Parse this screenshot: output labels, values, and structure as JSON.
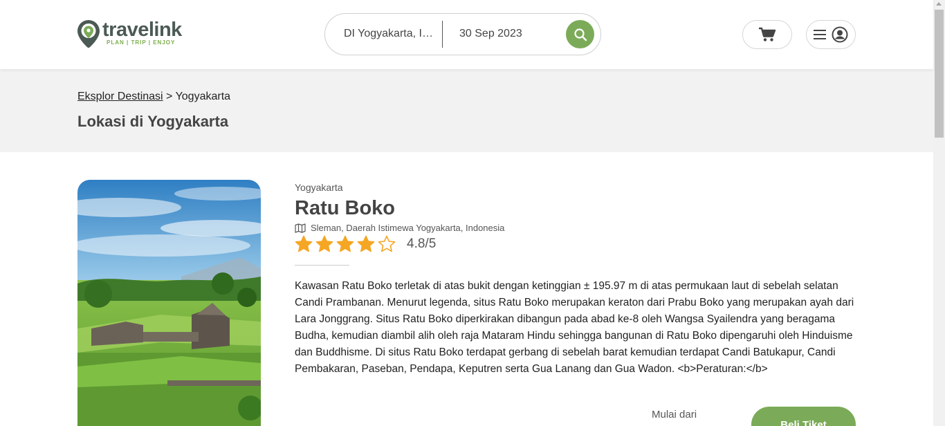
{
  "header": {
    "logo_name": "travelink",
    "logo_tagline": "PLAN | TRIP | ENJOY",
    "search": {
      "location": "DI Yogyakarta, Indonesia",
      "date": "30 Sep 2023"
    },
    "icons": {
      "search": "search-icon",
      "cart": "cart-icon",
      "menu": "hamburger-icon",
      "account": "user-icon"
    }
  },
  "banner": {
    "breadcrumb_link": "Eksplor Destinasi",
    "breadcrumb_separator": " > ",
    "breadcrumb_current": "Yogyakarta",
    "title": "Lokasi di Yogyakarta"
  },
  "destination": {
    "region": "Yogyakarta",
    "name": "Ratu Boko",
    "address": "Sleman, Daerah Istimewa Yogyakarta, Indonesia",
    "rating_text": "4.8/5",
    "stars_filled": 4,
    "stars_total": 5,
    "description": "Kawasan Ratu Boko terletak di atas bukit dengan ketinggian ± 195.97 m di atas permukaan laut di sebelah selatan Candi Prambanan. Menurut legenda, situs Ratu Boko merupakan keraton dari Prabu Boko yang merupakan ayah dari Lara Jonggrang. Situs Ratu Boko diperkirakan dibangun pada abad ke-8 oleh Wangsa Syailendra yang beragama Budha, kemudian diambil alih oleh raja Mataram Hindu sehingga bangunan di Ratu Boko dipengaruhi oleh Hinduisme dan Buddhisme. Di situs Ratu Boko terdapat gerbang di sebelah barat kemudian terdapat Candi Batukapur, Candi Pembakaran, Paseban, Pendapa, Keputren serta Gua Lanang dan Gua Wadon. <b>Peraturan:</b>",
    "price_label": "Mulai dari",
    "buy_label": "Beli Tiket"
  },
  "colors": {
    "accent": "#7bab58",
    "star": "#f5a623",
    "logo_text": "#4b5a54",
    "banner_bg": "#f2f2f2"
  }
}
